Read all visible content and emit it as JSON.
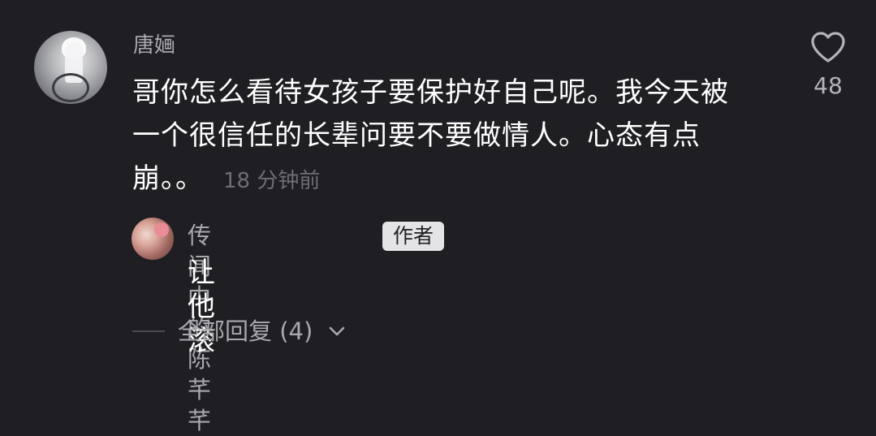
{
  "comment": {
    "author": "唐婳",
    "text": "哥你怎么看待女孩子要保护好自己呢。我今天被一个很信任的长辈问要不要做情人。心态有点崩。。",
    "time": "18 分钟前",
    "likes": "48",
    "like_icon": "heart-outline-icon"
  },
  "reply": {
    "author": "传闻中的陈芊芊",
    "badge": "作者",
    "text": "让他滚"
  },
  "expand": {
    "label": "全部回复 (4)",
    "icon": "chevron-down-icon"
  },
  "colors": {
    "background": "#1f1e22",
    "secondary_text": "#a9a9ad",
    "muted_text": "#6e6e73",
    "badge_bg": "#e4e4e7"
  }
}
